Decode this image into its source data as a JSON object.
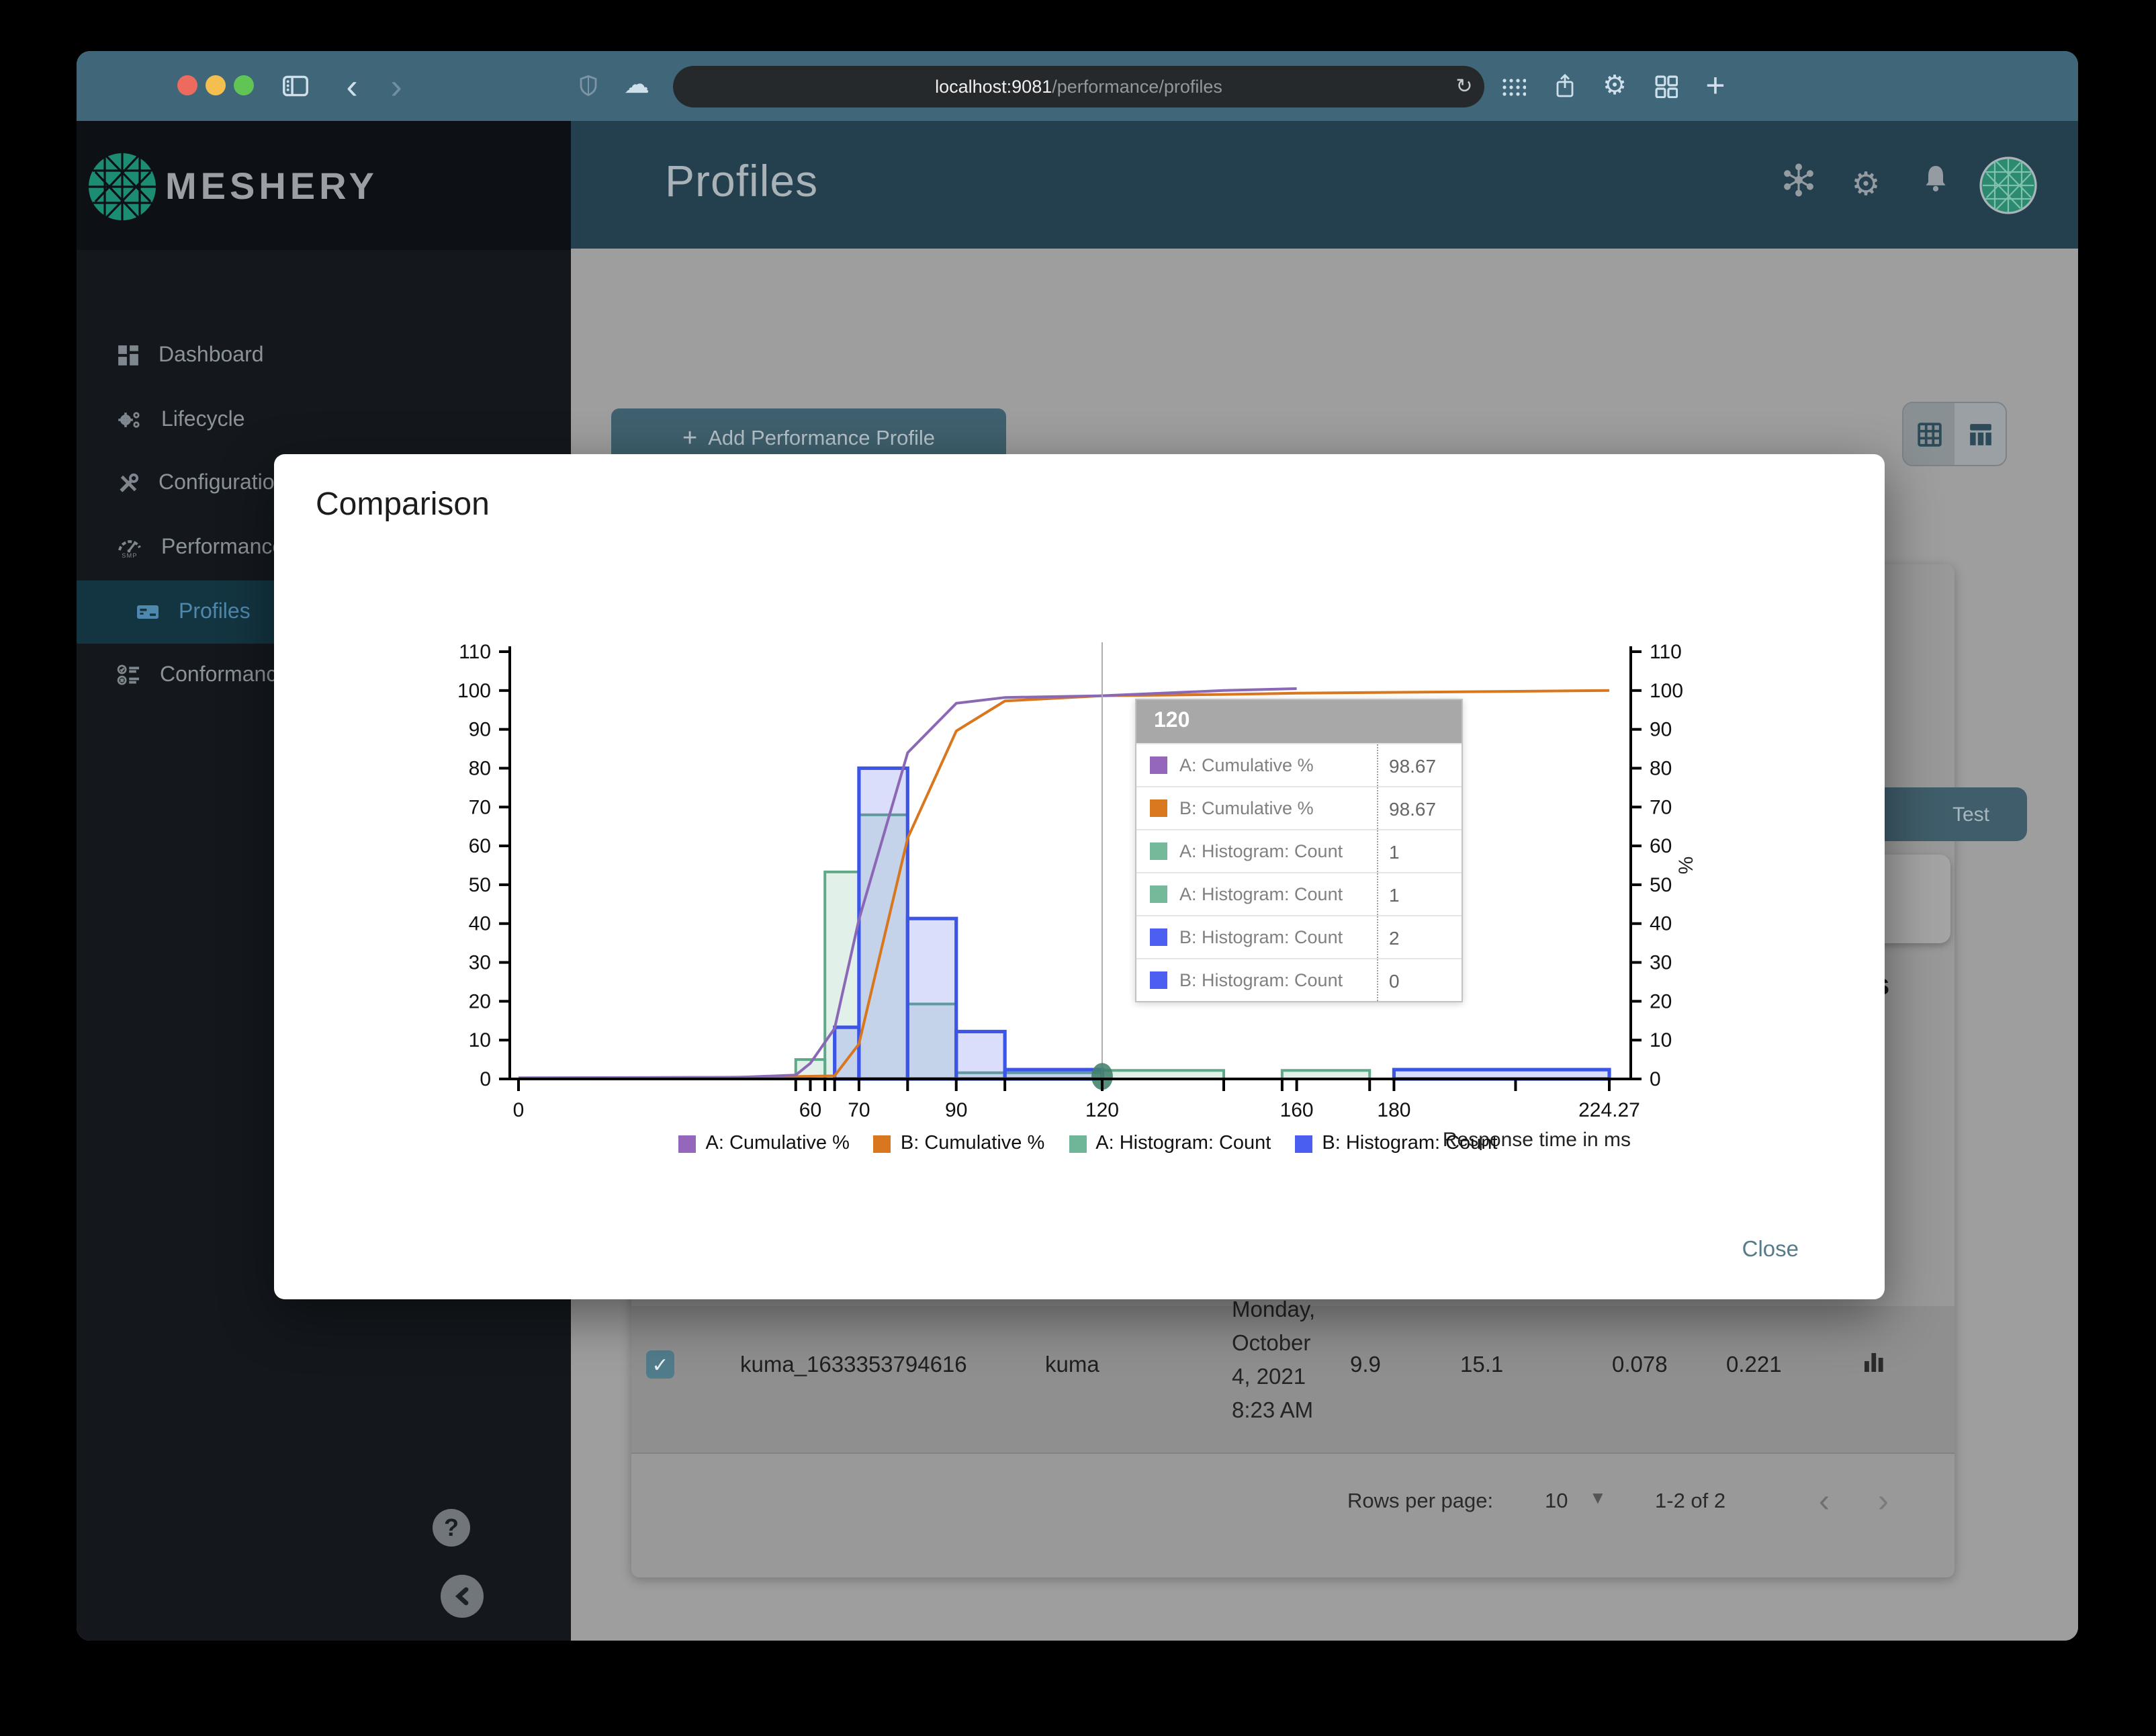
{
  "browser": {
    "url_host": "localhost:9081",
    "url_path": "/performance/profiles",
    "traffic_lights": [
      "#ed6a5e",
      "#f4bf4f",
      "#61c555"
    ]
  },
  "sidebar": {
    "logo_text": "MESHERY",
    "items": [
      {
        "label": "Dashboard"
      },
      {
        "label": "Lifecycle"
      },
      {
        "label": "Configuration"
      },
      {
        "label": "Performance"
      },
      {
        "label": "Profiles",
        "active": true
      },
      {
        "label": "Conformance"
      }
    ]
  },
  "header": {
    "title": "Profiles"
  },
  "background": {
    "add_profile_button": "Add Performance Profile",
    "test_button_fragment": "Test",
    "details_fragment": "ails",
    "row": {
      "id": "kuma_1633353794616",
      "mesh": "kuma",
      "date_lines": [
        "Monday,",
        "October",
        "4, 2021",
        "8:23 AM"
      ],
      "values": [
        "9.9",
        "15.1",
        "0.078",
        "0.221"
      ]
    },
    "pagination": {
      "label": "Rows per page:",
      "value": "10",
      "range": "1-2 of 2"
    }
  },
  "modal": {
    "title": "Comparison",
    "close_label": "Close",
    "tooltip": {
      "header": "120",
      "rows": [
        {
          "color": "#9467bd",
          "label": "A: Cumulative %",
          "value": "98.67"
        },
        {
          "color": "#d9781e",
          "label": "B: Cumulative %",
          "value": "98.67"
        },
        {
          "color": "#74b99a",
          "label": "A: Histogram: Count",
          "value": "1"
        },
        {
          "color": "#74b99a",
          "label": "A: Histogram: Count",
          "value": "1"
        },
        {
          "color": "#4d5ff0",
          "label": "B: Histogram: Count",
          "value": "2"
        },
        {
          "color": "#4d5ff0",
          "label": "B: Histogram: Count",
          "value": "0"
        }
      ]
    }
  },
  "chart_data": {
    "type": "combo",
    "xlabel": "Response time in ms",
    "ylabel_right": "%",
    "x_range": [
      0,
      224.27
    ],
    "y_range": [
      0,
      110
    ],
    "y_ticks": [
      0,
      10,
      20,
      30,
      40,
      50,
      60,
      70,
      80,
      90,
      100,
      110
    ],
    "x_major_ticks": [
      {
        "v": 0,
        "label": "0"
      },
      {
        "v": 60,
        "label": "60"
      },
      {
        "v": 70,
        "label": "70"
      },
      {
        "v": 90,
        "label": "90"
      },
      {
        "v": 120,
        "label": "120"
      },
      {
        "v": 160,
        "label": "160"
      },
      {
        "v": 180,
        "label": "180"
      },
      {
        "v": 224.27,
        "label": "224.27"
      }
    ],
    "x_minor_ticks": [
      57,
      63,
      65,
      80,
      100,
      145,
      157,
      175,
      205
    ],
    "series": [
      {
        "name": "A: Histogram: Count",
        "type": "bar",
        "stroke": "#5fa888",
        "fill": "rgba(111,181,152,0.20)",
        "bars": [
          [
            57,
            63,
            5
          ],
          [
            63,
            70,
            53.3
          ],
          [
            70,
            80,
            68
          ],
          [
            80,
            90,
            19.3
          ],
          [
            90,
            120,
            1.6
          ],
          [
            120,
            145,
            2.2
          ],
          [
            157,
            175,
            2.2
          ]
        ]
      },
      {
        "name": "B: Histogram: Count",
        "type": "bar",
        "stroke": "#3a55e8",
        "fill": "rgba(90,105,235,0.22)",
        "bars": [
          [
            65,
            70,
            13.3
          ],
          [
            70,
            80,
            80
          ],
          [
            80,
            90,
            41.3
          ],
          [
            90,
            100,
            12.2
          ],
          [
            100,
            120,
            2.4
          ],
          [
            180,
            224.27,
            2.4
          ]
        ]
      },
      {
        "name": "B: Cumulative %",
        "type": "line",
        "color": "#d9771e",
        "points": [
          [
            0,
            0.2
          ],
          [
            40,
            0.4
          ],
          [
            55,
            0.6
          ],
          [
            65,
            0.8
          ],
          [
            70,
            9
          ],
          [
            80,
            62
          ],
          [
            90,
            89.6
          ],
          [
            100,
            97.3
          ],
          [
            120,
            98.67
          ],
          [
            145,
            99
          ],
          [
            160,
            99.3
          ],
          [
            224.27,
            100
          ]
        ]
      },
      {
        "name": "A: Cumulative %",
        "type": "line",
        "color": "#8b68b5",
        "points": [
          [
            0,
            0.3
          ],
          [
            45,
            0.4
          ],
          [
            57,
            1
          ],
          [
            60,
            4
          ],
          [
            65,
            13
          ],
          [
            70,
            41
          ],
          [
            80,
            84
          ],
          [
            90,
            96.7
          ],
          [
            100,
            98.2
          ],
          [
            120,
            98.67
          ],
          [
            145,
            100
          ],
          [
            160,
            100.5
          ]
        ]
      }
    ],
    "hover": {
      "x": 120,
      "marker": {
        "x": 120,
        "y": 1,
        "color": "#41806b"
      }
    },
    "legend": [
      {
        "label": "A: Cumulative %",
        "color": "#9467bd"
      },
      {
        "label": "B: Cumulative %",
        "color": "#d9771e"
      },
      {
        "label": "A: Histogram: Count",
        "color": "#6fb598"
      },
      {
        "label": "B: Histogram: Count",
        "color": "#4a5ff0"
      }
    ]
  }
}
